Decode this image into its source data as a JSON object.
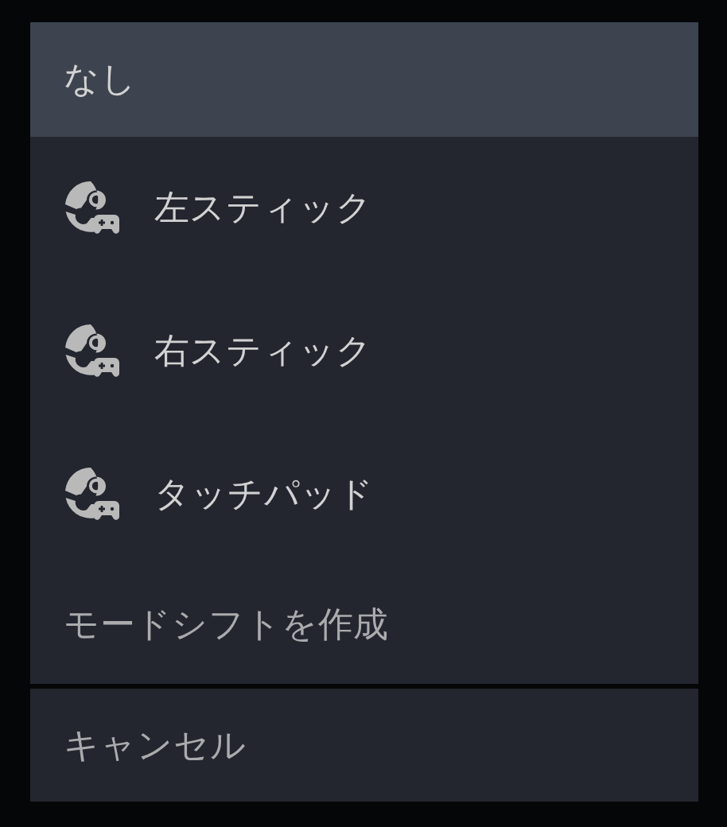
{
  "menu": {
    "items": [
      {
        "label": "なし",
        "kind": "plain",
        "selected": true
      },
      {
        "label": "左スティック",
        "kind": "controller",
        "selected": false
      },
      {
        "label": "右スティック",
        "kind": "controller",
        "selected": false
      },
      {
        "label": "タッチパッド",
        "kind": "controller",
        "selected": false
      },
      {
        "label": "モードシフトを作成",
        "kind": "action",
        "selected": false
      }
    ]
  },
  "cancel": {
    "label": "キャンセル"
  }
}
